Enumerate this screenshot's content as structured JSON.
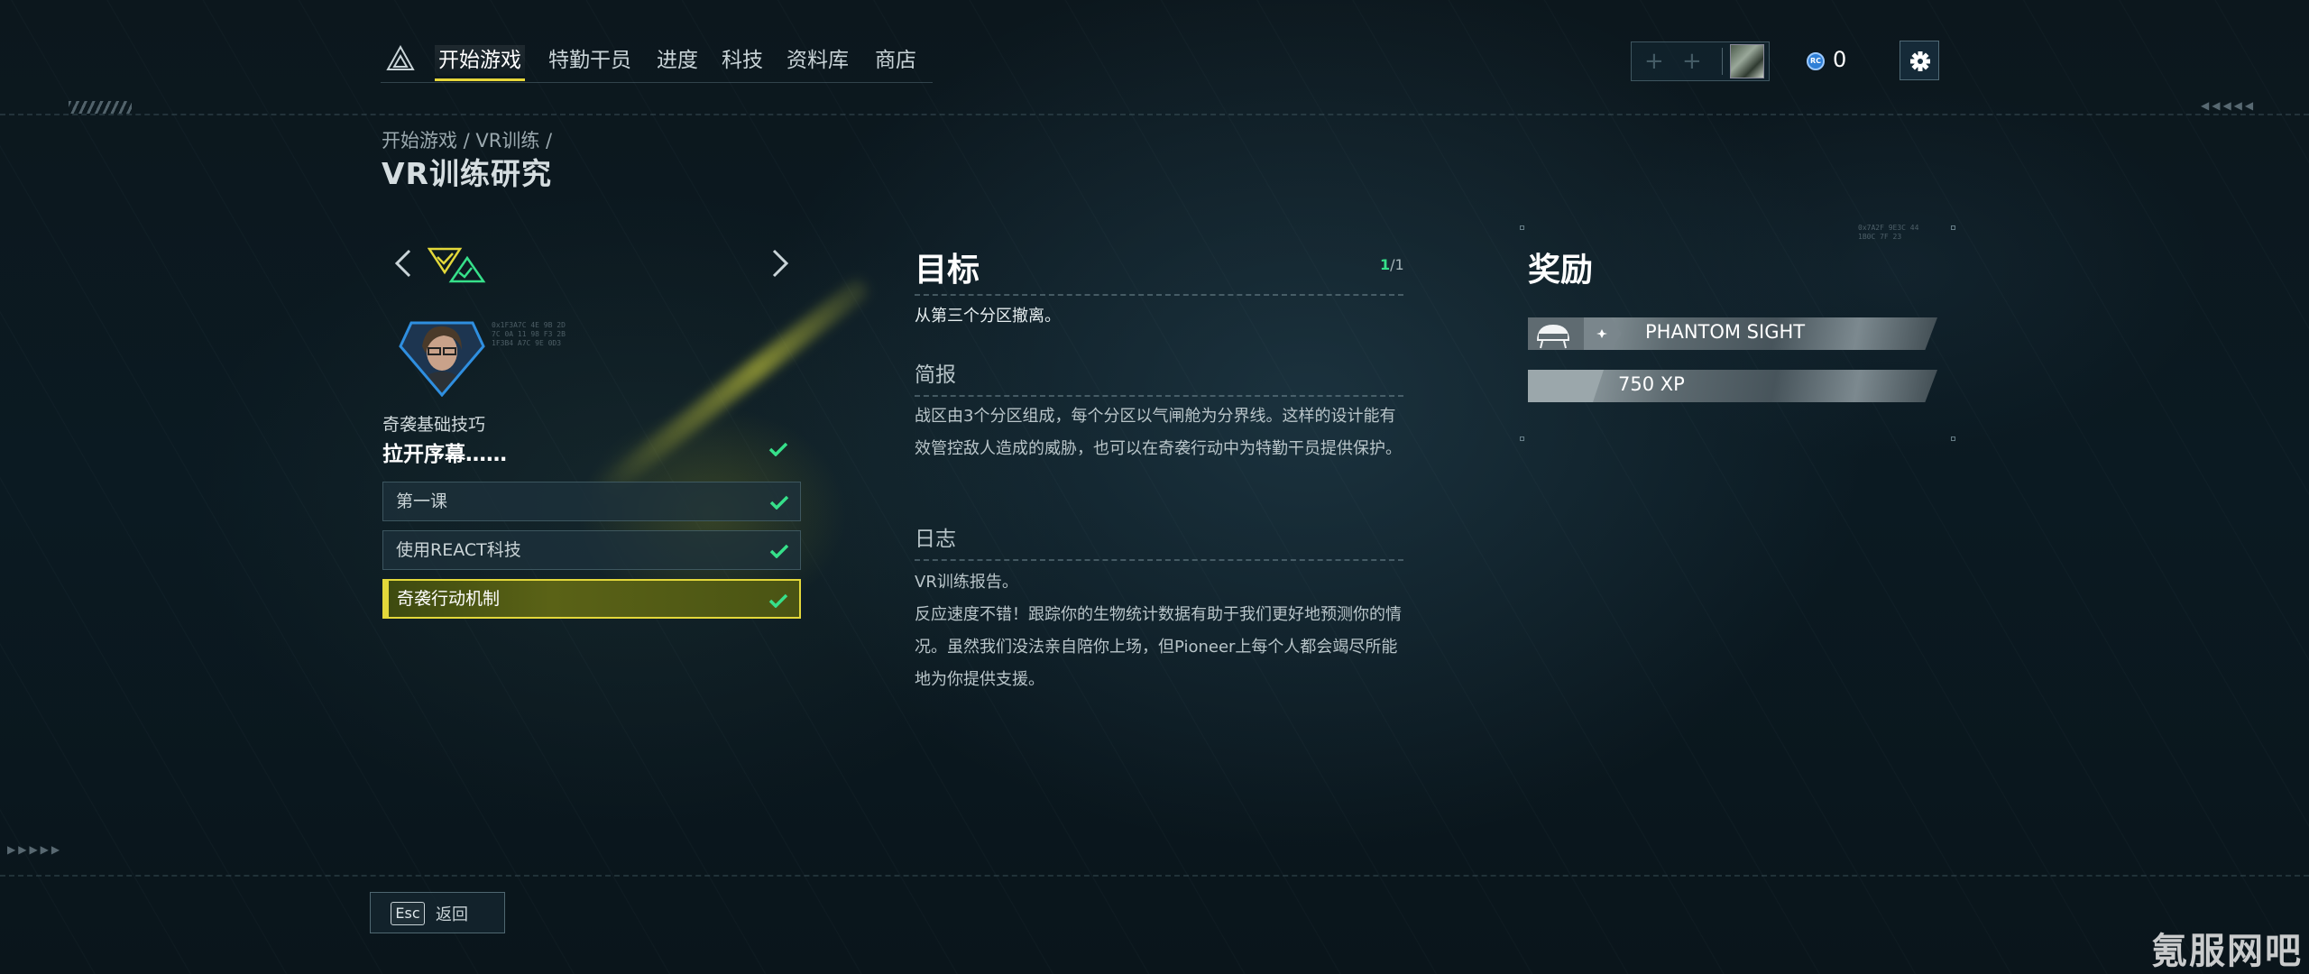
{
  "nav": {
    "tabs": [
      "开始游戏",
      "特勤干员",
      "进度",
      "科技",
      "资料库",
      "商店"
    ],
    "active_tab": 0
  },
  "currency": {
    "icon": "credits-icon",
    "value": "0"
  },
  "breadcrumb": "开始游戏 / VR训练 /",
  "page_title": "VR训练研究",
  "left_panel": {
    "category": "奇袭基础技巧",
    "chapter": "拉开序幕……",
    "lessons": [
      {
        "label": "第一课",
        "completed": true
      },
      {
        "label": "使用REACT科技",
        "completed": true
      },
      {
        "label": "奇袭行动机制",
        "completed": true
      }
    ],
    "active_lesson": 2
  },
  "objectives": {
    "title": "目标",
    "count_current": "1",
    "count_total": "/1",
    "text": "从第三个分区撤离。"
  },
  "briefing": {
    "title": "简报",
    "text": "战区由3个分区组成，每个分区以气闸舱为分界线。这样的设计能有效管控敌人造成的威胁，也可以在奇袭行动中为特勤干员提供保护。"
  },
  "log": {
    "title": "日志",
    "text": "VR训练报告。\n反应速度不错！跟踪你的生物统计数据有助于我们更好地预测你的情况。虽然我们没法亲自陪你上场，但Pioneer上每个人都会竭尽所能地为你提供支援。"
  },
  "rewards": {
    "title": "奖励",
    "items": [
      {
        "label": "PHANTOM SIGHT",
        "icon": "helmet-icon"
      },
      {
        "label": "750 XP",
        "icon": "xp-icon"
      }
    ]
  },
  "back": {
    "key": "Esc",
    "label": "返回"
  },
  "watermark": "氪服网吧",
  "colors": {
    "accent": "#e3d83a",
    "check": "#36e08a",
    "portrait_border": "#2f8fe0"
  }
}
